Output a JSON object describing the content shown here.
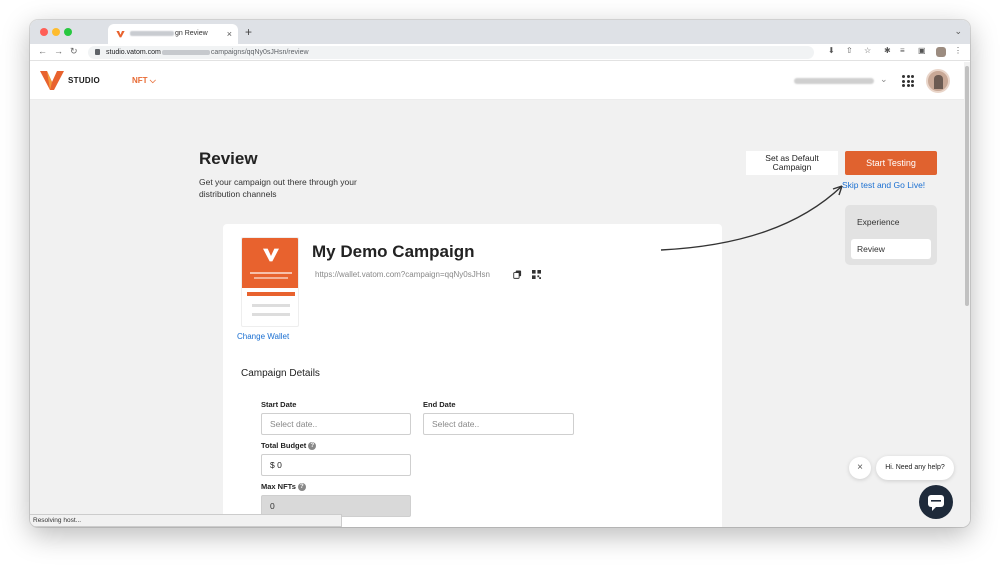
{
  "browser": {
    "tab_title_suffix": "gn Review",
    "tab_close": "×",
    "new_tab": "+",
    "url_host": "studio.vatom.com",
    "url_path": "campaigns/qqNy0sJHsn/review"
  },
  "header": {
    "brand": "STUDIO",
    "nft_menu": "NFT ⌵"
  },
  "page": {
    "title": "Review",
    "subtitle": "Get your campaign out there through your distribution channels",
    "default_button": "Set as Default Campaign",
    "start_button": "Start Testing",
    "skip_link": "Skip test and Go Live!"
  },
  "steps": [
    {
      "label": "Experience"
    },
    {
      "label": "Review"
    }
  ],
  "campaign": {
    "name": "My Demo Campaign",
    "url": "https://wallet.vatom.com?campaign=qqNy0sJHsn",
    "change_wallet": "Change Wallet",
    "section_title": "Campaign Details",
    "fields": {
      "start_date_label": "Start Date",
      "start_date_placeholder": "Select date..",
      "end_date_label": "End Date",
      "end_date_placeholder": "Select date..",
      "total_budget_label": "Total Budget",
      "total_budget_value": "$ 0",
      "max_nfts_label": "Max NFTs",
      "max_nfts_value": "0"
    }
  },
  "status_bar": "Resolving host...",
  "chat": {
    "prompt": "Hi. Need any help?",
    "close": "×"
  },
  "colors": {
    "accent": "#e0622f",
    "link": "#1a6fd1",
    "background": "#f1f1f1"
  }
}
